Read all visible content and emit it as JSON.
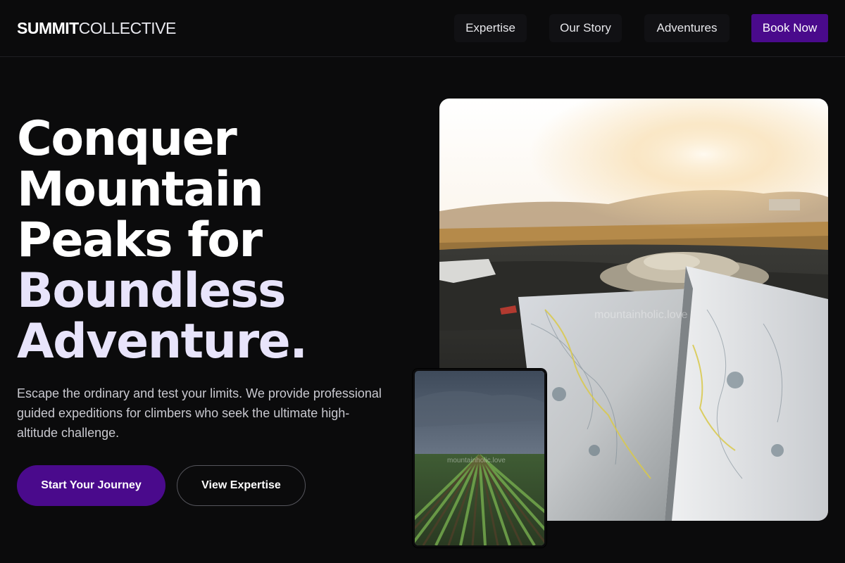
{
  "brand": {
    "bold": "SUMMIT",
    "light": "COLLECTIVE"
  },
  "nav": {
    "expertise": "Expertise",
    "story": "Our Story",
    "adventures": "Adventures",
    "book": "Book Now"
  },
  "hero": {
    "headline_lines": [
      "Conquer",
      "Mountain",
      "Peaks for"
    ],
    "accent_lines": [
      "Boundless",
      "Adventure."
    ],
    "subtext": "Escape the ordinary and test your limits. We provide professional guided expeditions for climbers who seek the ultimate high-altitude challenge.",
    "primary_cta": "Start Your Journey",
    "secondary_cta": "View Expertise"
  },
  "images": {
    "main_watermark": "mountainholic.love",
    "small_watermark": "mountainholic.love"
  },
  "colors": {
    "background": "#0b0b0c",
    "accent": "#4a0a8c",
    "headline_accent": "#e8e4fb"
  }
}
